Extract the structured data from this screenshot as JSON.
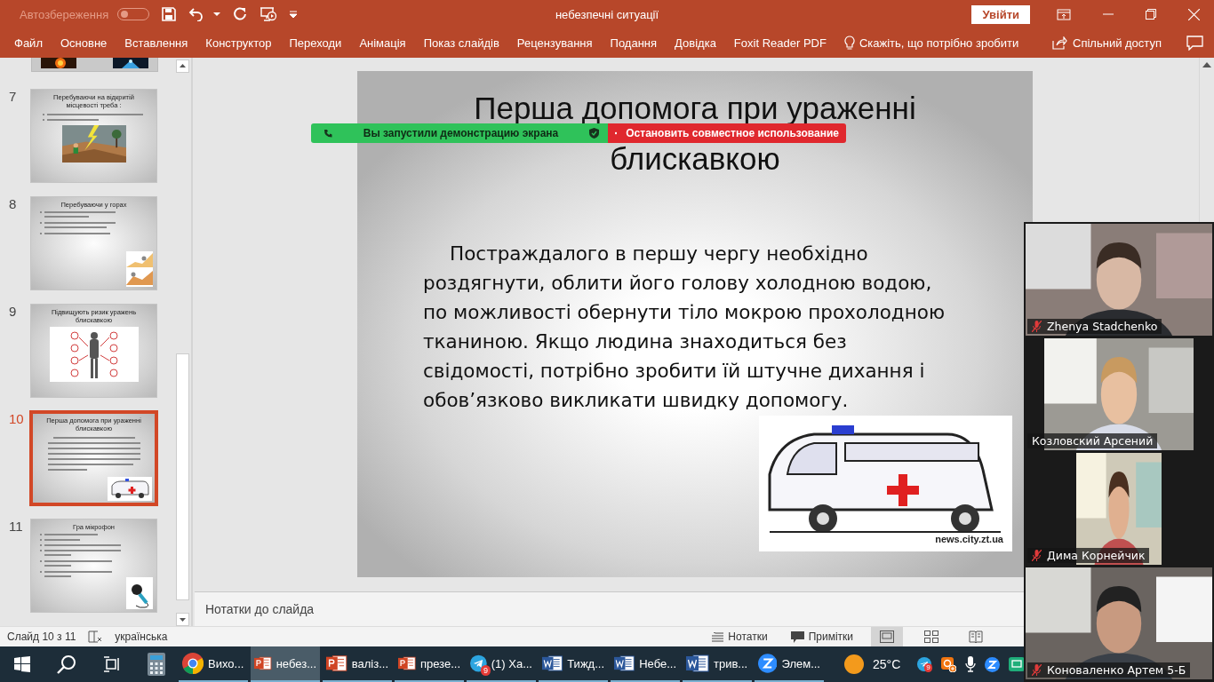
{
  "titlebar": {
    "autosave_label": "Автозбереження",
    "autosave_on": false,
    "title": "небезпечні ситуації",
    "signin": "Увійти"
  },
  "ribbon_tabs": [
    {
      "label": "Файл"
    },
    {
      "label": "Основне"
    },
    {
      "label": "Вставлення"
    },
    {
      "label": "Конструктор"
    },
    {
      "label": "Переходи"
    },
    {
      "label": "Анімація"
    },
    {
      "label": "Показ слайдів"
    },
    {
      "label": "Рецензування"
    },
    {
      "label": "Подання"
    },
    {
      "label": "Довідка"
    },
    {
      "label": "Foxit Reader PDF"
    }
  ],
  "tell_me": "Скажіть, що потрібно зробити",
  "share": "Спільний доступ",
  "slides": [
    {
      "number": "7",
      "title": "Перебуваючи на відкритій місцевості треба :",
      "kind": "field",
      "selected": false
    },
    {
      "number": "8",
      "title": "Перебуваючи у горах",
      "kind": "mountain",
      "selected": false
    },
    {
      "number": "9",
      "title": "Підвищують ризик уражень блискавкою",
      "kind": "infographic",
      "selected": false
    },
    {
      "number": "10",
      "title": "Перша допомога при ураженні блискавкою",
      "kind": "ambulance",
      "selected": true
    },
    {
      "number": "11",
      "title": "Гра мікрофон",
      "kind": "microphone",
      "selected": false
    }
  ],
  "slide": {
    "title_lines": [
      "Перша допомога при ураженні",
      "блискавкою"
    ],
    "body": "Постраждалого в першу чергу необхідно роздягнути, облити його голову холодною водою, по можливості обернути тіло мокрою прохолодною тканиною.  Якщо людина знаходиться без свідомості, потрібно зробити їй штучне дихання і обов’язково викликати швидку допомогу.",
    "image_credit": "news.city.zt.ua"
  },
  "notes_placeholder": "Нотатки до слайда",
  "share_banner": {
    "status": "Вы запустили демонстрацию экрана",
    "stop": "Остановить совместное использование"
  },
  "status_bar": {
    "slide": "Слайд 10 з 11",
    "language": "українська",
    "notes": "Нотатки",
    "comments": "Примітки",
    "views": [
      {
        "kind": "normal",
        "selected": true
      },
      {
        "kind": "sorter",
        "selected": false
      },
      {
        "kind": "reading",
        "selected": false
      }
    ]
  },
  "taskbar": {
    "apps": [
      {
        "kind": "chrome",
        "label": "Вихо...",
        "selected": false
      },
      {
        "kind": "powerpoint",
        "label": "небез...",
        "selected": true
      },
      {
        "kind": "powerpoint",
        "label": "валіз...",
        "selected": false
      },
      {
        "kind": "powerpoint",
        "label": "презе...",
        "selected": false
      },
      {
        "kind": "telegram",
        "label": "(1) Ха...",
        "badge": "9",
        "selected": false
      },
      {
        "kind": "word",
        "label": "Тижд...",
        "selected": false
      },
      {
        "kind": "word",
        "label": "Небе...",
        "selected": false
      },
      {
        "kind": "word",
        "label": "трив...",
        "selected": false
      },
      {
        "kind": "zoom",
        "label": "Элем...",
        "selected": false
      }
    ],
    "weather": "25°C",
    "tray": [
      {
        "kind": "telegram",
        "badge": "9"
      },
      {
        "kind": "share"
      },
      {
        "kind": "microphone"
      },
      {
        "kind": "zoom"
      },
      {
        "kind": "cast"
      }
    ]
  },
  "participants": [
    {
      "name": "Zhenya Stadchenko",
      "muted": true,
      "kind": "wide"
    },
    {
      "name": "Козловский Арсений",
      "muted": false,
      "kind": "medium"
    },
    {
      "name": "Дима Корнейчик",
      "muted": true,
      "kind": "narrow"
    },
    {
      "name": "Коноваленко Артем 5-Б",
      "muted": true,
      "kind": "wide"
    }
  ]
}
